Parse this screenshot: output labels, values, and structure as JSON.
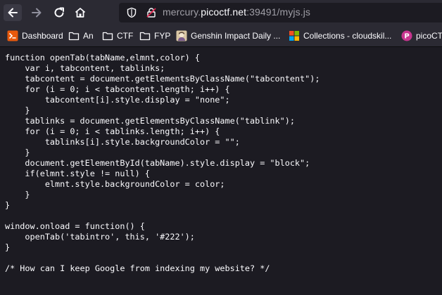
{
  "browser": {
    "url_prefix": "mercury.",
    "url_host": "picoctf.net",
    "url_suffix": ":39491/myjs.js"
  },
  "bookmarks": [
    {
      "label": "Dashboard",
      "icon": "dashboard-favicon"
    },
    {
      "label": "An",
      "icon": "folder-icon"
    },
    {
      "label": "CTF",
      "icon": "folder-icon"
    },
    {
      "label": "FYP",
      "icon": "folder-icon"
    },
    {
      "label": "Genshin Impact Daily ...",
      "icon": "genshin-favicon"
    },
    {
      "label": "Collections - cloudskil...",
      "icon": "microsoft-favicon"
    },
    {
      "label": "picoCT",
      "icon": "picoctf-favicon"
    }
  ],
  "source_code": "function openTab(tabName,elmnt,color) {\n    var i, tabcontent, tablinks;\n    tabcontent = document.getElementsByClassName(\"tabcontent\");\n    for (i = 0; i < tabcontent.length; i++) {\n        tabcontent[i].style.display = \"none\";\n    }\n    tablinks = document.getElementsByClassName(\"tablink\");\n    for (i = 0; i < tablinks.length; i++) {\n        tablinks[i].style.backgroundColor = \"\";\n    }\n    document.getElementById(tabName).style.display = \"block\";\n    if(elmnt.style != null) {\n        elmnt.style.backgroundColor = color;\n    }\n}\n\nwindow.onload = function() {\n    openTab('tabintro', this, '#222');\n}\n\n/* How can I keep Google from indexing my website? */",
  "colors": {
    "toolbar": "#2b2a33",
    "page_background": "#1c1b22",
    "text": "#fbfbfe",
    "url_dim": "#9f9ea6",
    "folder": "#fbfbfe"
  }
}
